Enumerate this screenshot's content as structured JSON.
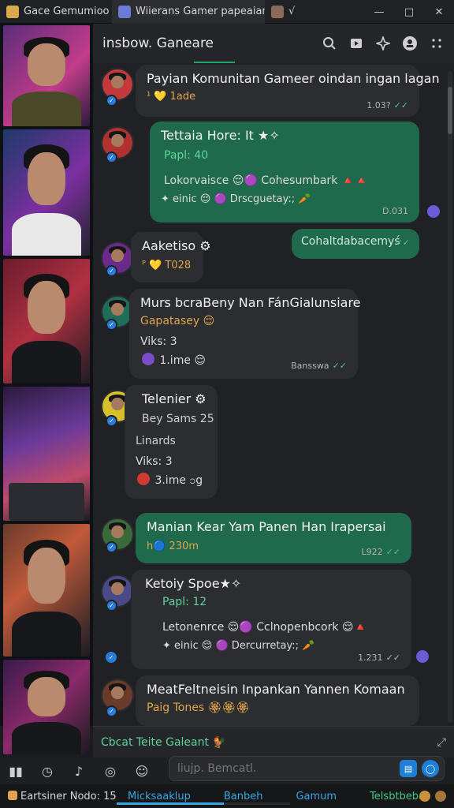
{
  "tabs": [
    {
      "label": "Gace Gemumioo",
      "favicon_color": "#d9a84a"
    },
    {
      "label": "Wiierans Gamer papeaiam",
      "favicon_color": "#6b7bd6"
    },
    {
      "label": "√",
      "favicon_color": "#8a6a58"
    }
  ],
  "window_controls": {
    "minimize": "—",
    "maximize": "□",
    "close": "✕"
  },
  "header": {
    "title": "insbow. Ganeare",
    "icons": [
      "search-icon",
      "video-icon",
      "sparkle-icon",
      "account-icon",
      "more-icon"
    ]
  },
  "messages": [
    {
      "name": "Payian Komunitan Gameer oindan ingan lagan",
      "lines": [
        "¹ 💛 1ade"
      ],
      "time": "1.03?",
      "ticks": "✓✓",
      "style": "dark"
    },
    {
      "name": "Tettaia Hore: It ★✧",
      "lines": [
        "Papl: 40",
        "Lokorvaisce 😌🟣 Cohesumbark 🔺🔺",
        "✦ einic 😌 🟣 Drscguetay:; 🥕"
      ],
      "time": "D.031",
      "style": "green"
    },
    {
      "name": "Cohaltdabacemyś",
      "time": "",
      "ticks": "✓✓",
      "style": "green-small"
    },
    {
      "name": "Aaketiso ⚙",
      "lines": [
        "ᴾ 💛 T028"
      ],
      "style": "dark"
    },
    {
      "name": "Murs bcraBeny Nan FánGialunsiare",
      "lines": [
        "Gapatasey 😌",
        "Viks: 3",
        "1.ime 😌"
      ],
      "time": "Bansswa",
      "ticks": "✓✓",
      "style": "dark"
    },
    {
      "name": "Telenier ⚙",
      "lines": [
        "Bey Sams 25",
        "Linards",
        "Viks: 3",
        "3.ime ၁g"
      ],
      "style": "dark"
    },
    {
      "name": "Manian Kear Yam Panen Han Irapersai",
      "lines": [
        "h🔵 230m"
      ],
      "time": "L922",
      "ticks": "✓✓",
      "style": "green"
    },
    {
      "name": "Ketoiy Spoe★✧",
      "lines": [
        "Papl: 12",
        "Letonenrce 😌🟣 Cclnopenbcork 😌🔺",
        "✦ einic 😌 🟣 Dercurretay:; 🥕"
      ],
      "time": "1.231",
      "ticks": "✓✓",
      "style": "dark"
    },
    {
      "name": "MeatFeltneisin Inpankan Yannen Komaan",
      "lines": [
        "Paig Tones 🏵🏵🏵"
      ],
      "style": "dark"
    }
  ],
  "composer": {
    "text": "Cbcat Teite Galeant 🐓",
    "placeholder": "liujp. Bemcatl."
  },
  "toolbar_icons": [
    "book-icon",
    "clock-icon",
    "shape-icon",
    "gamepad-icon",
    "sticker-icon"
  ],
  "status": {
    "left": "Eartsiner Nodo: 15",
    "tabs": [
      "Micksaaklup",
      "Banbeh",
      "Gamum",
      "Telsbtbeba"
    ],
    "progress": 0.62
  }
}
